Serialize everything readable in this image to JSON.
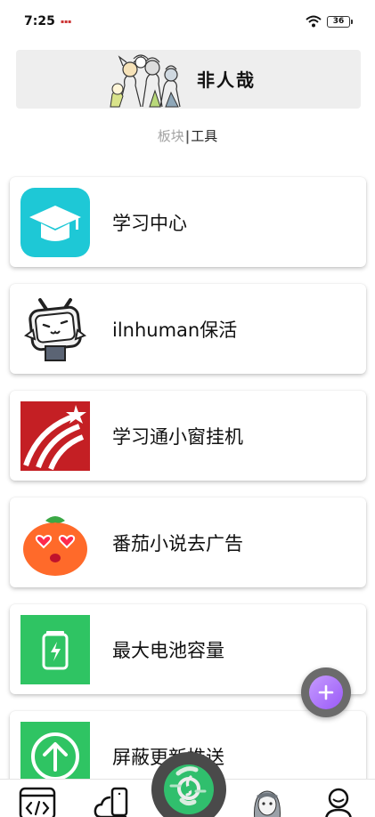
{
  "status_bar": {
    "time": "7:25",
    "battery": "36"
  },
  "banner": {
    "title": "非人哉"
  },
  "section_tabs": {
    "first": "板块",
    "separator": "|",
    "second": "工具"
  },
  "tools": [
    {
      "label": "学习中心",
      "icon": "graduation-cap-icon",
      "color": "#1ec8d6"
    },
    {
      "label": "ilnhuman保活",
      "icon": "bilibili-tv-mascot-icon",
      "color": "#ffffff"
    },
    {
      "label": "学习通小窗挂机",
      "icon": "chaoxing-logo-icon",
      "color": "#c41f24"
    },
    {
      "label": "番茄小说去广告",
      "icon": "tomato-mascot-icon",
      "color": "#ff6a2a"
    },
    {
      "label": "最大电池容量",
      "icon": "battery-icon",
      "color": "#2fc463"
    },
    {
      "label": "屏蔽更新推送",
      "icon": "arrow-up-circle-icon",
      "color": "#2fc463"
    }
  ],
  "fab": {
    "icon": "plus-icon"
  },
  "bottom_nav": [
    {
      "icon": "code-icon"
    },
    {
      "icon": "cloud-device-icon"
    },
    {
      "icon": "netease-music-icon"
    },
    {
      "icon": "anime-avatar-icon"
    },
    {
      "icon": "person-icon"
    }
  ]
}
